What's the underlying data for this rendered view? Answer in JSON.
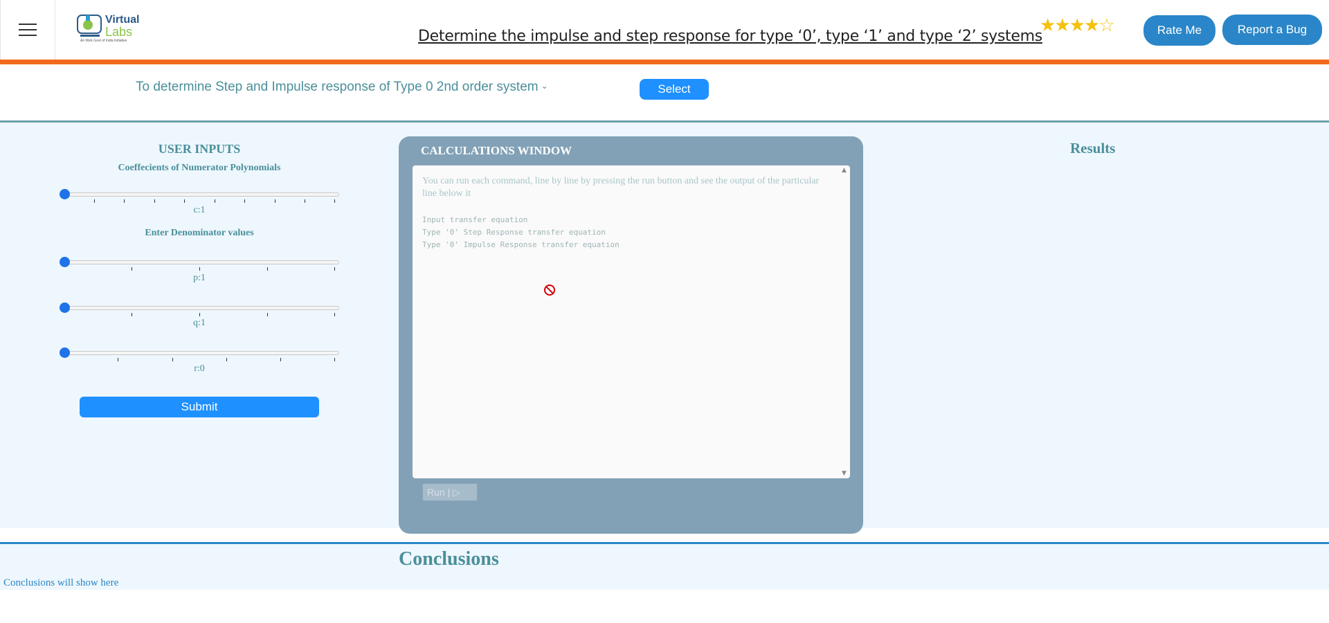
{
  "header": {
    "logo_line1": "Virtual",
    "logo_line2": "Labs",
    "logo_tagline": "An MoE Govt of India Initiative",
    "title": "Determine the impulse and step response for type ‘0’, type ‘1’ and type ‘2’ systems",
    "rating_stars": "★★★★☆",
    "rating_value": 4.5,
    "rate_label": "Rate Me",
    "bug_label": "Report a Bug"
  },
  "experiment": {
    "selected": "To determine Step and Impulse response of Type 0 2nd order system",
    "select_label": "Select"
  },
  "user_inputs": {
    "title": "USER INPUTS",
    "numerator_heading": "Coeffecients of Numerator Polynomials",
    "denominator_heading": "Enter Denominator values",
    "c_label": "c:1",
    "p_label": "p:1",
    "q_label": "q:1",
    "r_label": "r:0",
    "submit_label": "Submit"
  },
  "calculations": {
    "title": "CALCULATIONS WINDOW",
    "hint": "You can run each command, line by line by pressing the run button and see the output of the particular line below it",
    "lines": [
      "Input transfer equation",
      "Type '0' Step Response transfer equation",
      "Type '0' Impulse Response transfer equation"
    ],
    "run_label": "Run | ▷"
  },
  "results": {
    "title": "Results"
  },
  "conclusions": {
    "title": "Conclusions",
    "text": "Conclusions will show here"
  },
  "colors": {
    "accent_orange": "#f26b1d",
    "button_blue": "#1e90ff",
    "teal_text": "#4a8f9a",
    "panel_bg": "#eef7fd",
    "calc_bg": "#82a1b6"
  }
}
